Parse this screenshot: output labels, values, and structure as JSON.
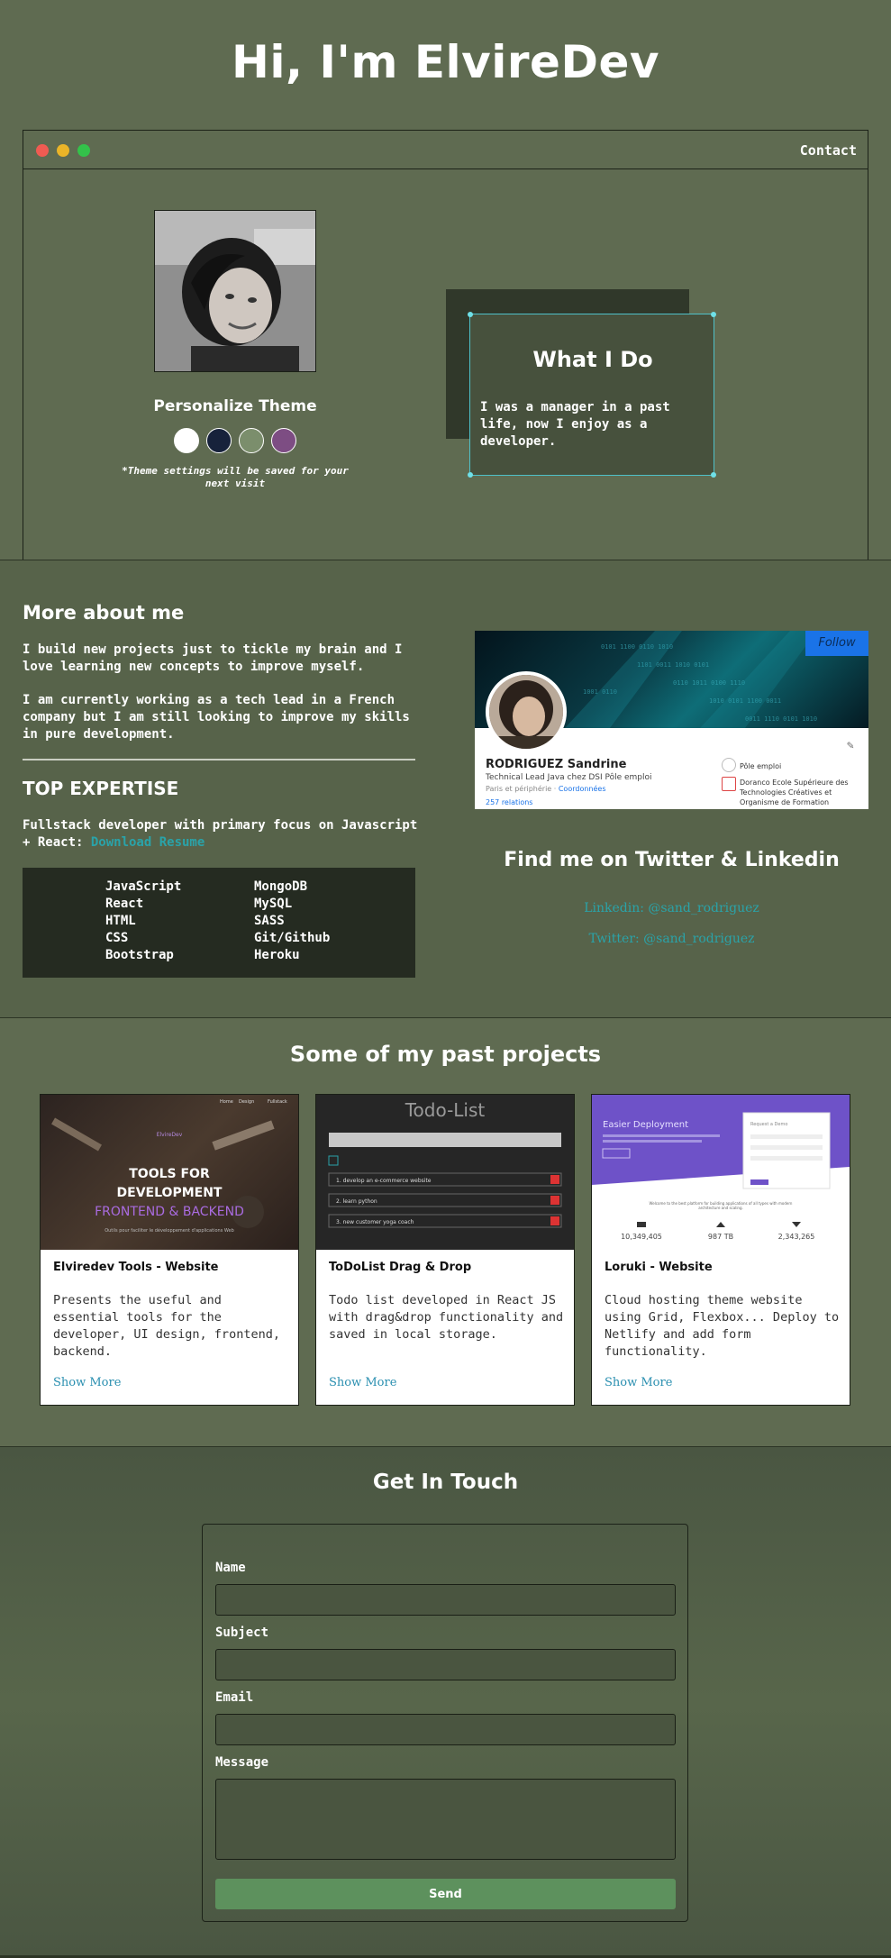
{
  "hero": {
    "title": "Hi, I'm ElvireDev",
    "contact_link": "Contact"
  },
  "personalize": {
    "title": "Personalize Theme",
    "note": "*Theme settings will be saved for your next visit",
    "themes": [
      {
        "name": "light",
        "color": "#ffffff"
      },
      {
        "name": "blue",
        "color": "#17223b"
      },
      {
        "name": "green",
        "color": "#7b8e6c"
      },
      {
        "name": "purple",
        "color": "#7d4d83"
      }
    ]
  },
  "whatido": {
    "title": "What I Do",
    "text": "I was a manager in a past life, now I enjoy as a developer."
  },
  "about": {
    "title": "More about me",
    "p1": "I build new projects just to tickle my brain and I love learning new concepts to improve myself.",
    "p2": "I am currently working as a tech lead in a French company but I am still looking to improve my skills in pure development.",
    "expertise_title": "TOP EXPERTISE",
    "expertise_text": "Fullstack developer with primary focus on Javascript + React: ",
    "resume_link": "Download Resume",
    "skills": [
      "JavaScript",
      "React",
      "HTML",
      "CSS",
      "Bootstrap",
      "MongoDB",
      "MySQL",
      "SASS",
      "Git/Github",
      "Heroku"
    ]
  },
  "linkedin_card": {
    "follow": "Follow",
    "name": "RODRIGUEZ Sandrine",
    "job": "Technical Lead Java chez DSI Pôle emploi",
    "place": "Paris et périphérie · ",
    "coords": "Coordonnées",
    "relations": "257 relations",
    "org1": "Pôle emploi",
    "org2": "Doranco Ecole Supérieure des Technologies Créatives et Organisme de Formation"
  },
  "social": {
    "title": "Find me on Twitter & Linkedin",
    "linkedin": "Linkedin: @sand_rodriguez",
    "twitter": "Twitter: @sand_rodriguez"
  },
  "projects": {
    "title": "Some of my past projects",
    "cards": [
      {
        "title": "Elviredev Tools - Website",
        "desc": "Presents the useful and essential tools for the developer, UI design, frontend, backend.",
        "more": "Show More",
        "img_lines": [
          "ElvireDev",
          "TOOLS FOR",
          "DEVELOPMENT",
          "FRONTEND & BACKEND",
          "Outils pour faciliter le développement d'applications Web"
        ],
        "img_nav": [
          "Home",
          "Design",
          "Fullstack"
        ]
      },
      {
        "title": "ToDoList Drag & Drop",
        "desc": "Todo list developed in React JS with drag&drop functionality and saved in local storage.",
        "more": "Show More",
        "img_title": "Todo-List",
        "img_items": [
          "1. develop an e-commerce website",
          "2. learn python",
          "3. new customer yoga coach"
        ]
      },
      {
        "title": "Loruki - Website",
        "desc": "Cloud hosting theme website using Grid, Flexbox... Deploy to Netlify and add form functionality.",
        "more": "Show More",
        "img_title": "Easier Deployment",
        "img_form_title": "Request a Demo",
        "img_welcome": "Welcome to the best platform for building applications of all types with modern architecture and scaling.",
        "img_stats": [
          "10,349,405",
          "987 TB",
          "2,343,265"
        ]
      }
    ]
  },
  "contact": {
    "title": "Get In Touch",
    "name_label": "Name",
    "subject_label": "Subject",
    "email_label": "Email",
    "message_label": "Message",
    "send": "Send"
  },
  "colors": {
    "background": "#5f6b51",
    "section_dark": "#57634a",
    "accent": "#2aa3a9",
    "send_button": "#5d915d"
  }
}
